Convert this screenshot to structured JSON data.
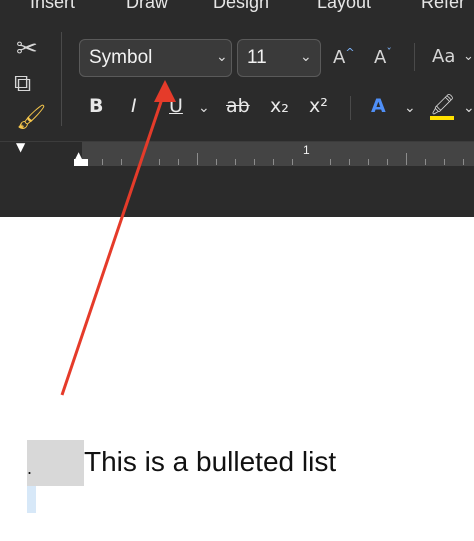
{
  "tabs": [
    "Insert",
    "Draw",
    "Design",
    "Layout",
    "Refer"
  ],
  "clipboard": {
    "cut_icon": "scissors-icon",
    "copy_icon": "copy-icon",
    "format_painter_icon": "paintbrush-icon"
  },
  "font": {
    "family": "Symbol",
    "size": "11"
  },
  "font_tools": {
    "increase": "A^",
    "decrease": "Aˇ",
    "case": "Aa",
    "bold": "B",
    "italic": "I",
    "underline": "U",
    "strikethrough": "ab",
    "subscript": "x₂",
    "superscript": "x²",
    "text_effects": "A",
    "highlight": "highlight-icon"
  },
  "ruler": {
    "marker": "1"
  },
  "document": {
    "bullet_text": "This is a bulleted list",
    "bullet_marker": "."
  },
  "annotation": {
    "arrow_color": "#e53b2a"
  }
}
